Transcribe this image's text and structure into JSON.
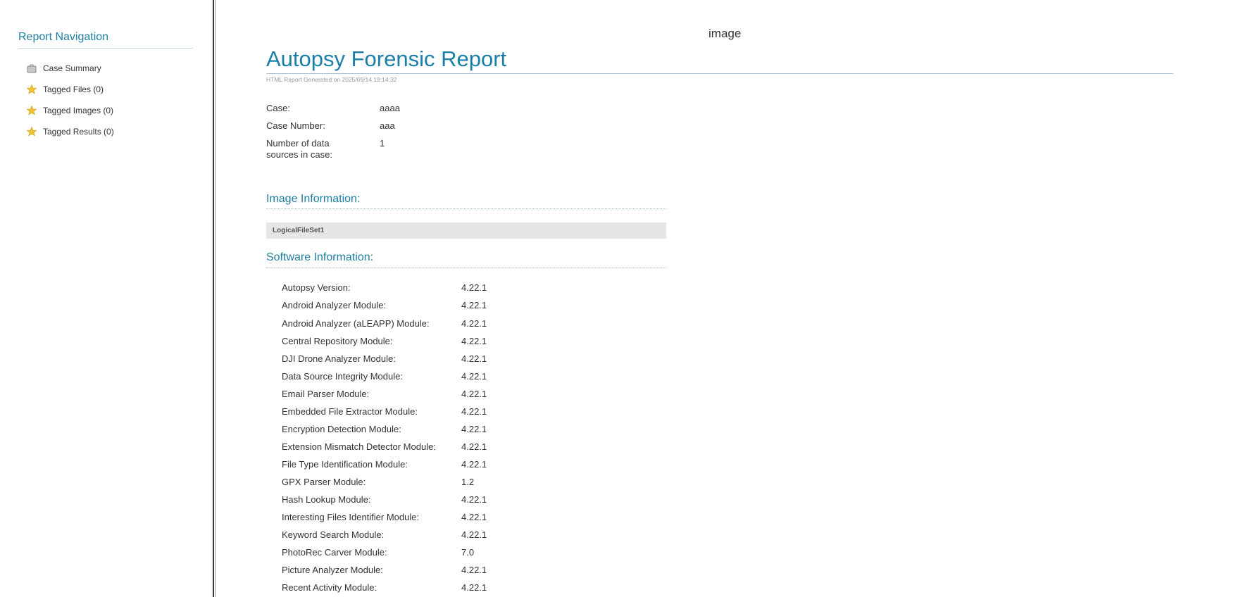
{
  "nav": {
    "title": "Report Navigation",
    "items": [
      {
        "label": "Case Summary",
        "icon": "briefcase-icon"
      },
      {
        "label": "Tagged Files (0)",
        "icon": "star-icon"
      },
      {
        "label": "Tagged Images (0)",
        "icon": "star-icon"
      },
      {
        "label": "Tagged Results (0)",
        "icon": "star-icon"
      }
    ]
  },
  "main": {
    "image_label": "image",
    "title": "Autopsy Forensic Report",
    "generated": "HTML Report Generated on 2025/09/14 19:14:32",
    "case_info": [
      {
        "label": "Case:",
        "value": "aaaa"
      },
      {
        "label": "Case Number:",
        "value": "aaa"
      },
      {
        "label": "Number of data sources in case:",
        "value": "1"
      }
    ],
    "image_section_title": "Image Information:",
    "image_name": "LogicalFileSet1",
    "software_section_title": "Software Information:",
    "software": [
      {
        "name": "Autopsy Version:",
        "version": "4.22.1"
      },
      {
        "name": "Android Analyzer Module:",
        "version": "4.22.1"
      },
      {
        "name": "Android Analyzer (aLEAPP) Module:",
        "version": "4.22.1"
      },
      {
        "name": "Central Repository Module:",
        "version": "4.22.1"
      },
      {
        "name": "DJI Drone Analyzer Module:",
        "version": "4.22.1"
      },
      {
        "name": "Data Source Integrity Module:",
        "version": "4.22.1"
      },
      {
        "name": "Email Parser Module:",
        "version": "4.22.1"
      },
      {
        "name": "Embedded File Extractor Module:",
        "version": "4.22.1"
      },
      {
        "name": "Encryption Detection Module:",
        "version": "4.22.1"
      },
      {
        "name": "Extension Mismatch Detector Module:",
        "version": "4.22.1"
      },
      {
        "name": "File Type Identification Module:",
        "version": "4.22.1"
      },
      {
        "name": "GPX Parser Module:",
        "version": "1.2"
      },
      {
        "name": "Hash Lookup Module:",
        "version": "4.22.1"
      },
      {
        "name": "Interesting Files Identifier Module:",
        "version": "4.22.1"
      },
      {
        "name": "Keyword Search Module:",
        "version": "4.22.1"
      },
      {
        "name": "PhotoRec Carver Module:",
        "version": "7.0"
      },
      {
        "name": "Picture Analyzer Module:",
        "version": "4.22.1"
      },
      {
        "name": "Recent Activity Module:",
        "version": "4.22.1"
      }
    ]
  }
}
